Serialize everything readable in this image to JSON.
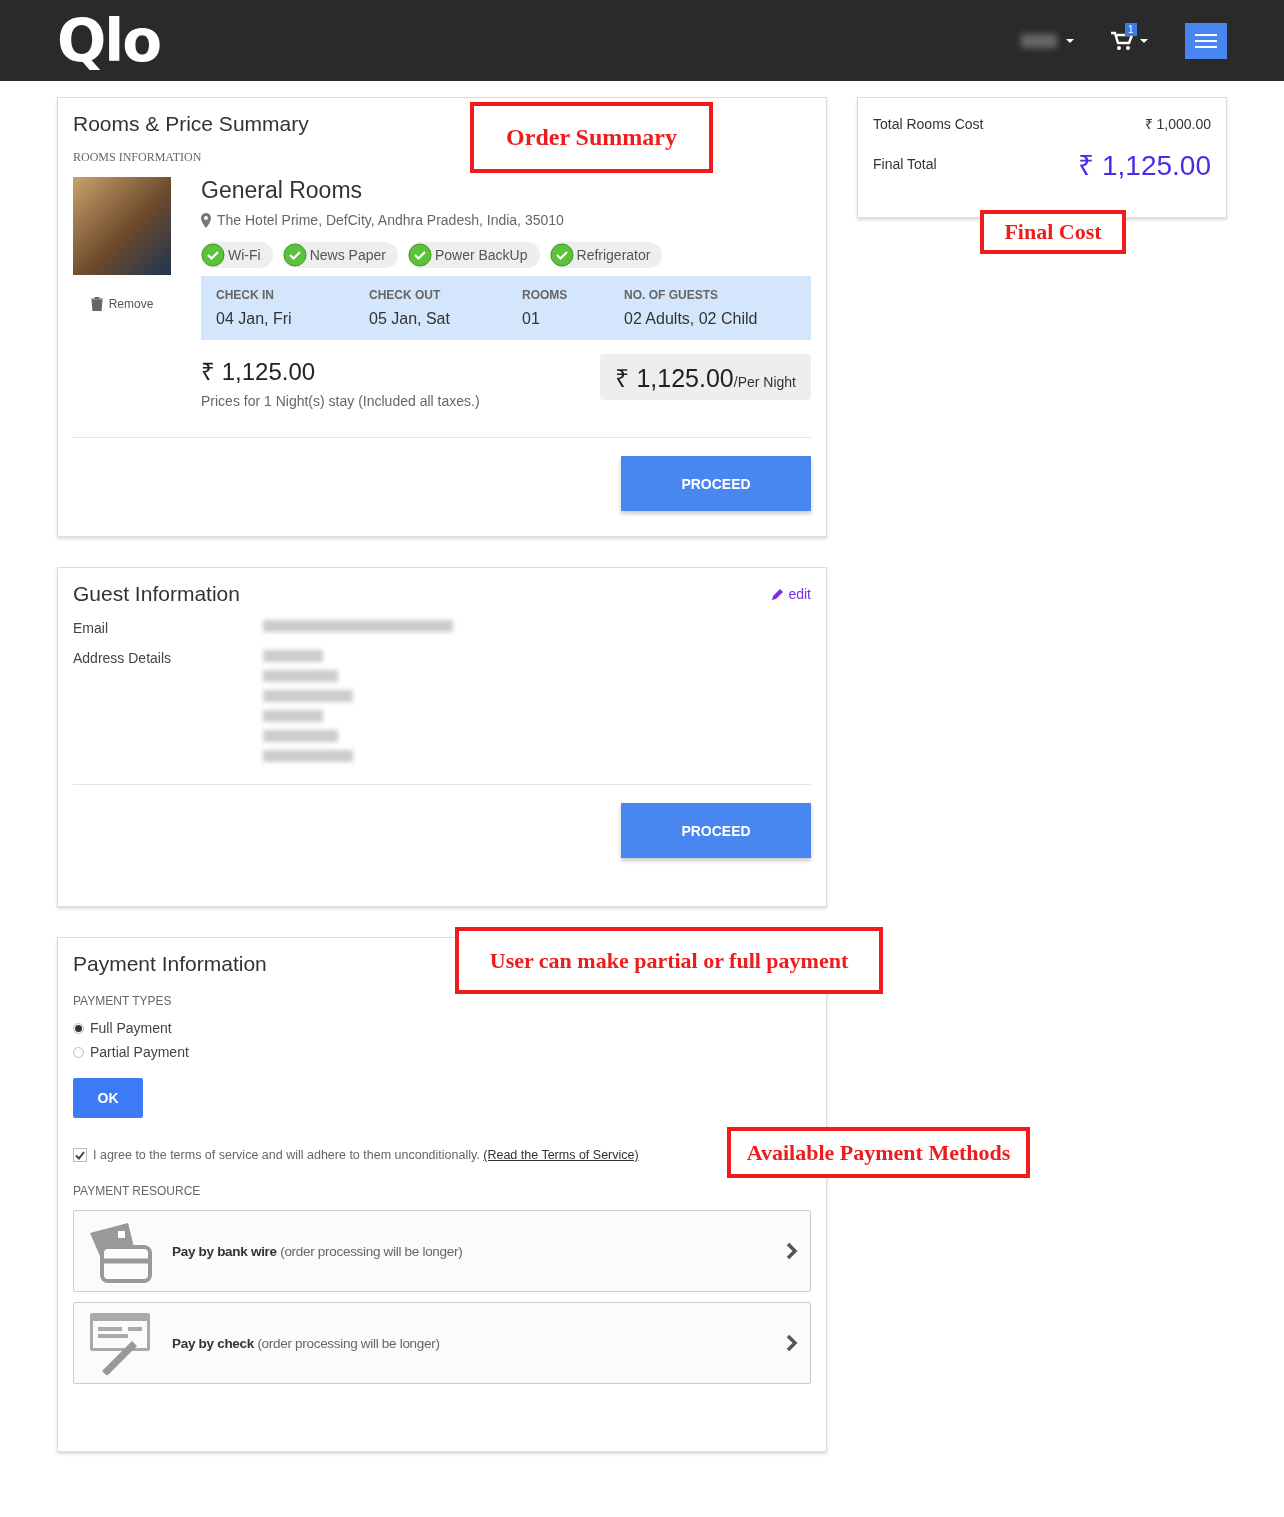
{
  "header": {
    "logo": "Qlo",
    "cart_count": "1"
  },
  "rooms_card": {
    "title": "Rooms & Price Summary",
    "section_label": "ROOMS INFORMATION",
    "room_name": "General Rooms",
    "address": "The Hotel Prime, DefCity, Andhra Pradesh, India, 35010",
    "remove": "Remove",
    "amenities": [
      "Wi-Fi",
      "News Paper",
      "Power BackUp",
      "Refrigerator"
    ],
    "details": [
      {
        "label": "CHECK IN",
        "value": "04 Jan, Fri"
      },
      {
        "label": "CHECK OUT",
        "value": "05 Jan, Sat"
      },
      {
        "label": "ROOMS",
        "value": "01"
      },
      {
        "label": "NO. OF GUESTS",
        "value": "02 Adults, 02 Child"
      }
    ],
    "price": "₹ 1,125.00",
    "price_note": "Prices for 1 Night(s) stay (Included all taxes.)",
    "per_night_price": "₹ 1,125.00",
    "per_night_unit": "/Per Night",
    "button": "PROCEED"
  },
  "totals": [
    {
      "label": "Total Rooms Cost",
      "value": "₹ 1,000.00",
      "kind": "normal"
    },
    {
      "label": "Final Total",
      "value": "₹ 1,125.00",
      "kind": "grand"
    }
  ],
  "guest_card": {
    "title": "Guest Information",
    "edit": "edit",
    "fields": [
      {
        "label": "Email"
      },
      {
        "label": "Address Details"
      }
    ],
    "button": "PROCEED"
  },
  "payment_card": {
    "title": "Payment Information",
    "types_label": "PAYMENT TYPES",
    "types": [
      {
        "label": "Full Payment",
        "selected": true
      },
      {
        "label": "Partial Payment",
        "selected": false
      }
    ],
    "ok": "OK",
    "terms": {
      "checked": true,
      "text": "I agree to the terms of service and will adhere to them unconditionally.",
      "link": "(Read the Terms of Service)"
    },
    "resource_label": "PAYMENT RESOURCE",
    "methods": [
      {
        "kind": "wire",
        "text": "**Pay by bank wire** (order processing will be longer)"
      },
      {
        "kind": "check",
        "text": "**Pay by check** (order processing will be longer)"
      }
    ]
  },
  "annotations": [
    {
      "text": "Order Summary",
      "kind": "order"
    },
    {
      "text": "Final Cost",
      "kind": "final"
    },
    {
      "text": "User can make partial or full payment",
      "kind": "partial"
    },
    {
      "text": "Available Payment Methods",
      "kind": "methods"
    }
  ]
}
